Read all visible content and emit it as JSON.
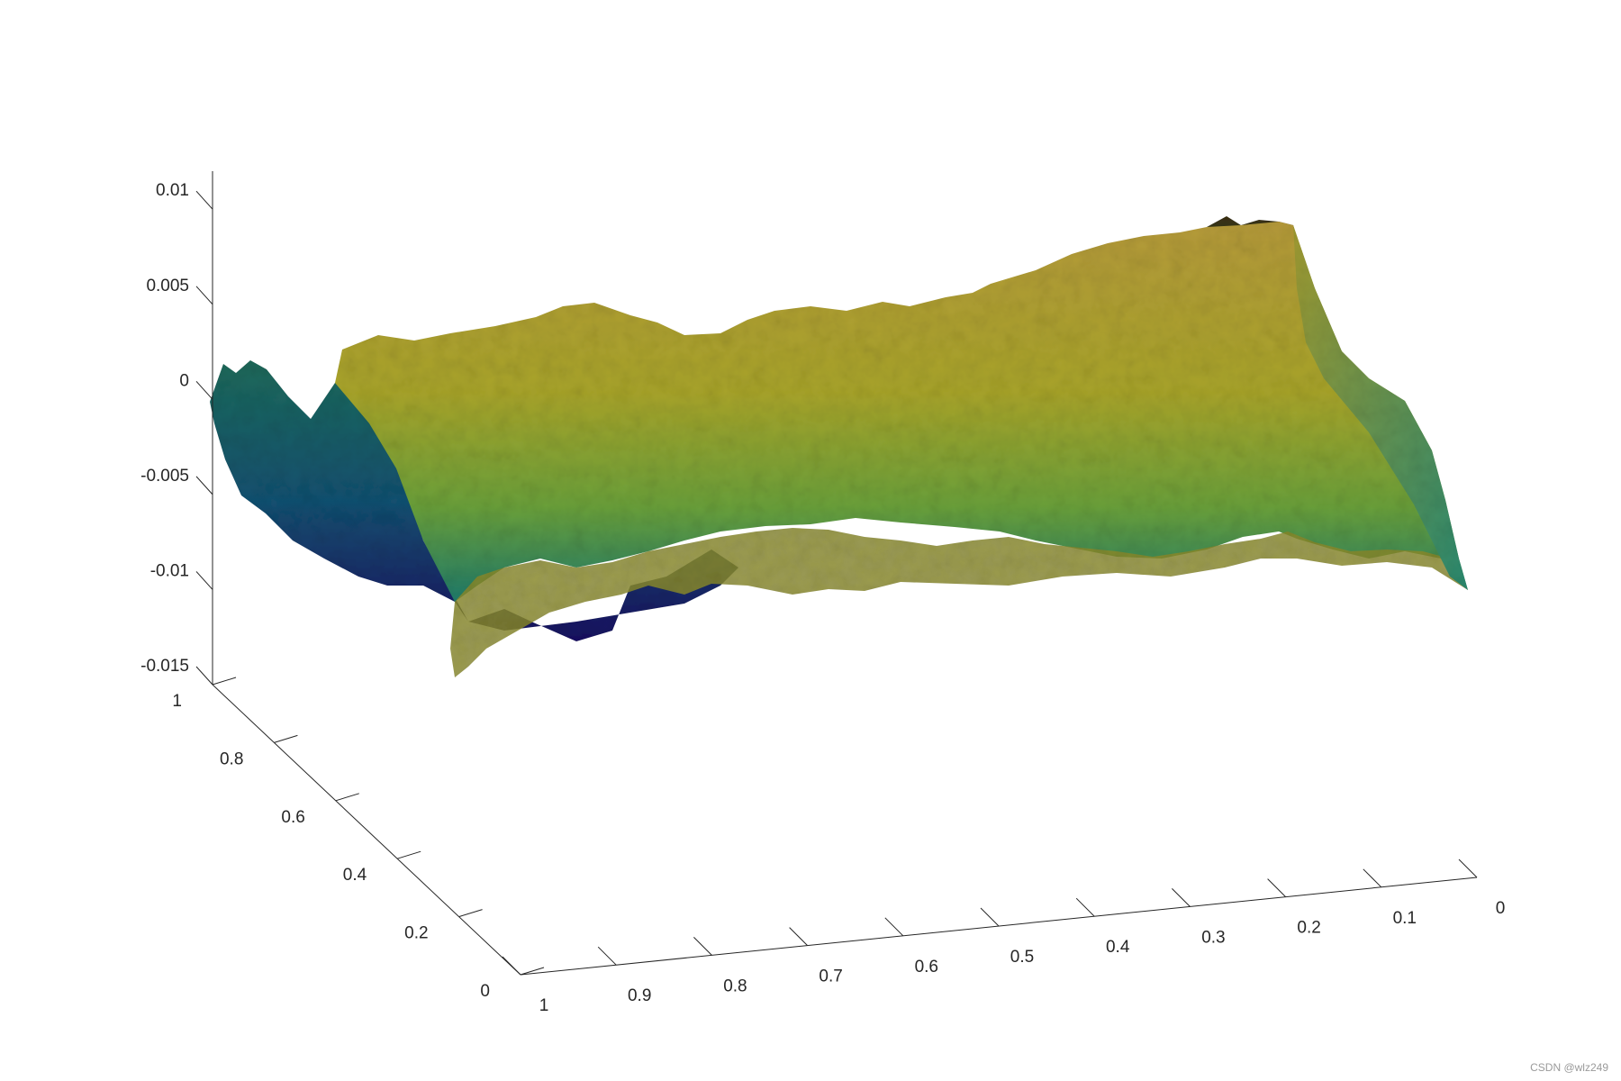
{
  "chart_data": {
    "type": "surface",
    "x_axis": {
      "ticks": [
        0,
        0.1,
        0.2,
        0.3,
        0.4,
        0.5,
        0.6,
        0.7,
        0.8,
        0.9,
        1
      ],
      "tick_labels": [
        "0",
        "0.1",
        "0.2",
        "0.3",
        "0.4",
        "0.5",
        "0.6",
        "0.7",
        "0.8",
        "0.9",
        "1"
      ],
      "range": [
        0,
        1
      ],
      "direction": "decreasing to the right"
    },
    "y_axis": {
      "ticks": [
        0,
        0.2,
        0.4,
        0.6,
        0.8,
        1
      ],
      "tick_labels": [
        "0",
        "0.2",
        "0.4",
        "0.6",
        "0.8",
        "1"
      ],
      "range": [
        0,
        1
      ]
    },
    "z_axis": {
      "ticks": [
        -0.015,
        -0.01,
        -0.005,
        0,
        0.005,
        0.01
      ],
      "tick_labels": [
        "-0.015",
        "-0.01",
        "-0.005",
        "0",
        "0.005",
        "0.01"
      ],
      "range": [
        -0.015,
        0.012
      ]
    },
    "grid": false,
    "colormap": [
      "#1a1060",
      "#114a6a",
      "#1f7a6e",
      "#5a9a3a",
      "#a3a525",
      "#b39a33",
      "#5a4a20"
    ],
    "surface_profile": {
      "description_values": "approximate z (height) along the four edges of the rough surface",
      "edge_x0_y1": [
        0.0095,
        0.007,
        0.004,
        0.001,
        -0.003,
        -0.008,
        -0.0095
      ],
      "edge_x1_y1": [
        -0.0005,
        -0.0015,
        0.002,
        0.001,
        -0.002,
        -0.006,
        -0.009
      ],
      "edge_x1_y0": [
        -0.004,
        -0.01,
        -0.012,
        -0.011,
        -0.006
      ],
      "edge_x0_y0": [
        -0.007,
        -0.008,
        -0.0085,
        -0.009,
        -0.0095
      ]
    }
  },
  "watermark": "CSDN @wlz249"
}
